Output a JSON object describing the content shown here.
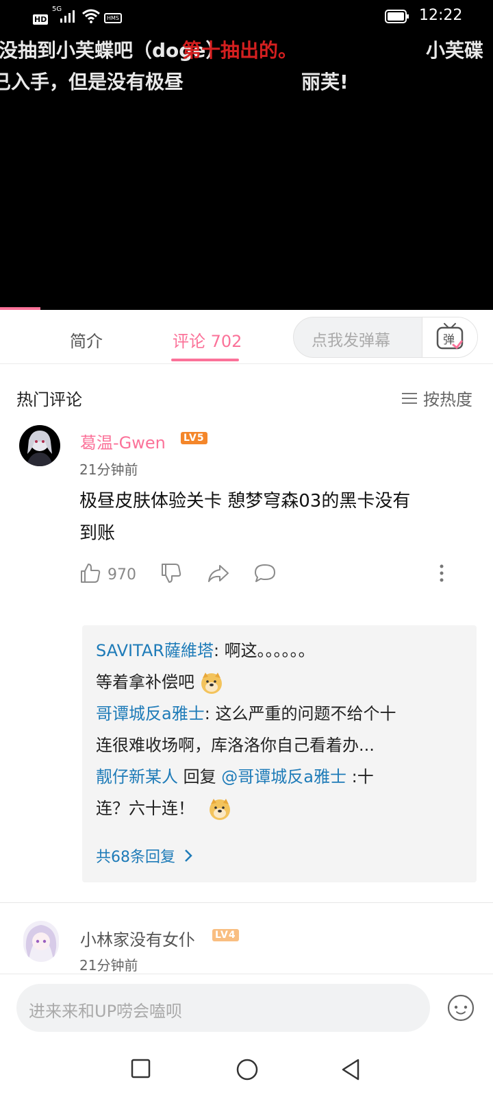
{
  "status_bar": {
    "network": "HD",
    "signal": "5G",
    "nfc": "HMS",
    "time": "12:22"
  },
  "danmaku": [
    "没抽到小芙蝶吧（doge）",
    "第十抽出的。",
    "小芙碟",
    "已入手，但是没有极昼",
    "丽芙!"
  ],
  "tabs": {
    "intro": "简介",
    "comments": "评论 702",
    "danmaku_placeholder": "点我发弹幕",
    "danmaku_btn": "弹"
  },
  "comments_section": {
    "title": "热门评论",
    "sort_label": "按热度"
  },
  "comments": [
    {
      "username": "葛温-Gwen",
      "level": "LV5",
      "time": "21分钟前",
      "text_line1": "极昼皮肤体验关卡 憩梦穹森03的黑卡没有",
      "text_line2": "到账",
      "likes": "970",
      "replies": [
        {
          "user": "SAVITAR薩維塔",
          "sep": ":",
          "text1": " 啊这。。。。。。",
          "text2": "等着拿补偿吧"
        },
        {
          "user": "哥谭城反a雅士",
          "sep": ":",
          "text1": " 这么严重的问题不给个十",
          "text2": "连很难收场啊，库洛洛你自己看着办..."
        },
        {
          "user": "靓仔新某人",
          "mid": " 回复 ",
          "mention": "@哥谭城反a雅士",
          "text1": " :十",
          "text2": "连？六十连！"
        }
      ],
      "more_replies": "共68条回复"
    },
    {
      "username": "小林家没有女仆",
      "level": "LV4",
      "time": "21分钟前"
    }
  ],
  "bottom": {
    "input_placeholder": "进来来和UP唠会嗑呗"
  },
  "colors": {
    "accent": "#fb7299",
    "link": "#1e7bb8",
    "lv5": "#f4862a",
    "lv4": "#f9be81"
  }
}
